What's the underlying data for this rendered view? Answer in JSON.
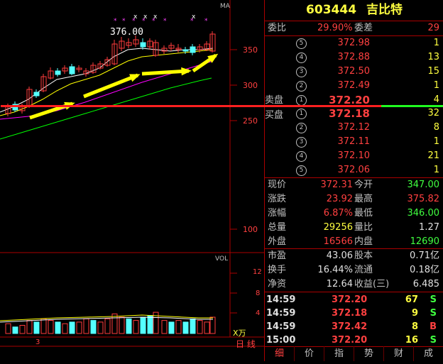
{
  "stock": {
    "code": "603444",
    "name": "吉比特"
  },
  "weibi": {
    "label": "委比",
    "value": "29.90%",
    "diff_label": "委差",
    "diff_value": "29"
  },
  "sell_label": "卖盘",
  "buy_label": "买盘",
  "sell_orders": [
    {
      "level": "5",
      "price": "372.98",
      "qty": "1"
    },
    {
      "level": "4",
      "price": "372.88",
      "qty": "13"
    },
    {
      "level": "3",
      "price": "372.50",
      "qty": "15"
    },
    {
      "level": "2",
      "price": "372.49",
      "qty": "1"
    },
    {
      "level": "1",
      "price": "372.20",
      "qty": "4"
    }
  ],
  "buy_orders": [
    {
      "level": "1",
      "price": "372.18",
      "qty": "32"
    },
    {
      "level": "2",
      "price": "372.12",
      "qty": "8"
    },
    {
      "level": "3",
      "price": "372.11",
      "qty": "1"
    },
    {
      "level": "4",
      "price": "372.10",
      "qty": "21"
    },
    {
      "level": "5",
      "price": "372.06",
      "qty": "1"
    }
  ],
  "quote": [
    {
      "l1": "现价",
      "v1": "372.31",
      "l2": "今开",
      "v2": "347.00"
    },
    {
      "l1": "涨跌",
      "v1": "23.92",
      "l2": "最高",
      "v2": "375.82"
    },
    {
      "l1": "涨幅",
      "v1": "6.87%",
      "l2": "最低",
      "v2": "346.00"
    },
    {
      "l1": "总量",
      "v1": "29256",
      "l2": "量比",
      "v2": "1.27"
    },
    {
      "l1": "外盘",
      "v1": "16566",
      "l2": "内盘",
      "v2": "12690"
    }
  ],
  "fundamentals": [
    {
      "l1": "市盈",
      "v1": "43.06",
      "l2": "股本",
      "v2": "0.71亿"
    },
    {
      "l1": "换手",
      "v1": "16.44%",
      "l2": "流通",
      "v2": "0.18亿"
    },
    {
      "l1": "净资",
      "v1": "12.64",
      "l2": "收益(三)",
      "v2": "6.485"
    }
  ],
  "ticks": [
    {
      "time": "14:59",
      "price": "372.20",
      "vol": "67",
      "side": "S"
    },
    {
      "time": "14:59",
      "price": "372.18",
      "vol": "9",
      "side": "S"
    },
    {
      "time": "14:59",
      "price": "372.42",
      "vol": "8",
      "side": "B"
    },
    {
      "time": "15:00",
      "price": "372.20",
      "vol": "16",
      "side": "S"
    }
  ],
  "tabs": [
    "细",
    "价",
    "指",
    "势",
    "财",
    "成"
  ],
  "chart": {
    "ma_label": "MA",
    "vol_label": "VOL",
    "price_ticks": [
      "350",
      "300",
      "250",
      "100"
    ],
    "vol_ticks": [
      "12",
      "8",
      "4"
    ],
    "vol_unit": "X万",
    "high_label": "376.00",
    "date_label": "3",
    "period_label": "日 线"
  },
  "colors": {
    "up": "#ff3c3c",
    "down": "#54ffff",
    "ma5": "#ffffff",
    "ma10": "#ffff00",
    "ma20": "#ff00ff",
    "ma60": "#00ff00",
    "arrow": "#ffff00"
  }
}
